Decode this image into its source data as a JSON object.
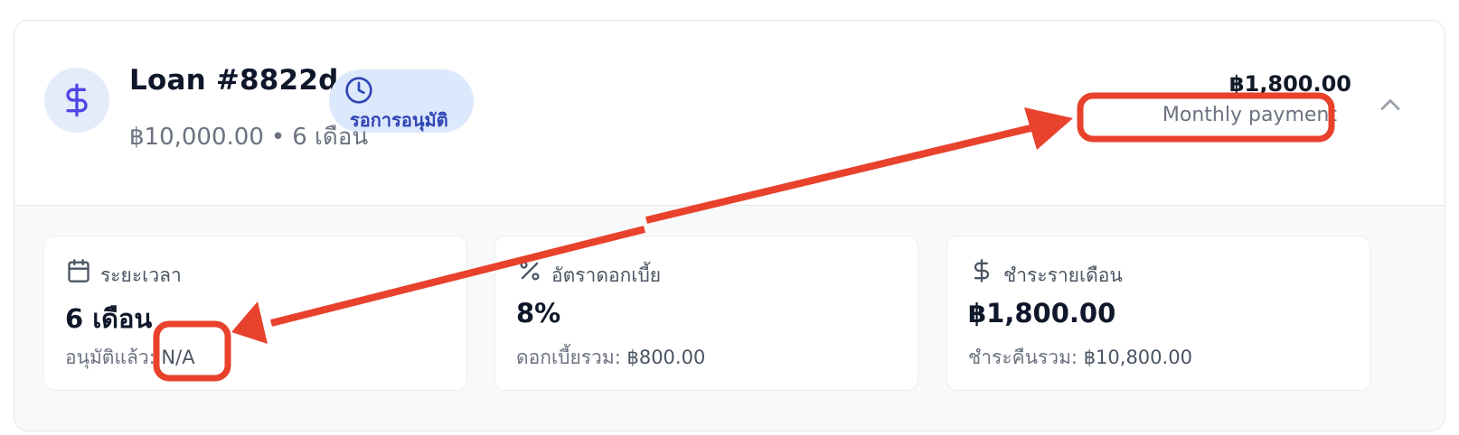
{
  "loan": {
    "title": "Loan #8822d",
    "status_badge": "รอการอนุมัติ",
    "principal": "฿10,000.00",
    "separator": "•",
    "term": "6 เดือน",
    "monthly_amount": "฿1,800.00",
    "monthly_caption": "Monthly payment"
  },
  "stats": [
    {
      "label": "ระยะเวลา",
      "value": "6 เดือน",
      "sub_label": "อนุมัติแล้ว:",
      "sub_value": "N/A",
      "icon": "calendar-icon"
    },
    {
      "label": "อัตราดอกเบี้ย",
      "value": "8%",
      "sub_label": "ดอกเบี้ยรวม:",
      "sub_value": "฿800.00",
      "icon": "percent-icon"
    },
    {
      "label": "ชำระรายเดือน",
      "value": "฿1,800.00",
      "sub_label": "ชำระคืนรวม:",
      "sub_value": "฿10,800.00",
      "icon": "dollar-icon"
    }
  ],
  "colors": {
    "accent": "#4f46e5",
    "badge_bg": "#dce8fb",
    "badge_text": "#2f44b5",
    "annotation": "#e8412c"
  }
}
